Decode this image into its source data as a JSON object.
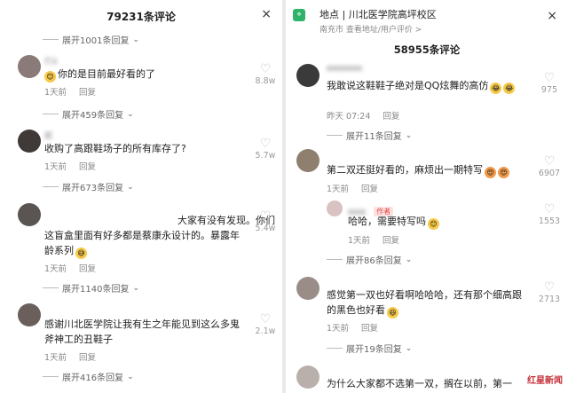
{
  "left": {
    "title": "79231条评论",
    "close_icon": "×",
    "top_expand": "展开1001条回复",
    "comments": [
      {
        "user": "打ǎ",
        "text1": "你的是目前最好看的了",
        "time": "1天前",
        "reply": "回复",
        "likes": "8.8w",
        "expand": "展开459条回复"
      },
      {
        "user": "妮",
        "text1": "收购了高跟鞋场子的所有库存了?",
        "time": "1天前",
        "reply": "回复",
        "likes": "5.7w",
        "expand": "展开673条回复"
      },
      {
        "user": "",
        "text1": "大家有没有发现。你们",
        "text2": "这盲盒里面有好多都是蔡康永设计的。暴露年",
        "text3": "龄系列",
        "time": "1天前",
        "reply": "回复",
        "likes": "5.4w",
        "expand": "展开1140条回复"
      },
      {
        "user": "",
        "text1": "感谢川北医学院让我有生之年能见到这么多鬼",
        "text2": "斧神工的丑鞋子",
        "time": "1天前",
        "reply": "回复",
        "likes": "2.1w",
        "expand": "展开416条回复"
      }
    ]
  },
  "right": {
    "location_title": "地点 | 川北医学院高坪校区",
    "location_sub": "南充市  查看地址/用户评价 >",
    "title": "58955条评论",
    "close_icon": "×",
    "comments": [
      {
        "text1": "我敢说这鞋鞋子绝对是QQ炫舞的高仿",
        "time": "昨天 07:24",
        "reply": "回复",
        "likes": "975",
        "expand": "展开11条回复"
      },
      {
        "text1": "第二双还挺好看的，麻烦出一期特写",
        "time": "1天前",
        "reply": "回复",
        "likes": "6907"
      },
      {
        "tag": "作者",
        "text1": "哈哈，需要特写吗",
        "time": "1天前",
        "reply": "回复",
        "likes": "1553",
        "expand": "展开86条回复"
      },
      {
        "text1": "感觉第一双也好看啊哈哈哈，还有那个细高跟",
        "text2": "的黑色也好看",
        "time": "1天前",
        "reply": "回复",
        "likes": "2713",
        "expand": "展开19条回复"
      },
      {
        "text1": "为什么大家都不选第一双，搁在以前，第一"
      }
    ],
    "watermark": "红星新闻"
  }
}
